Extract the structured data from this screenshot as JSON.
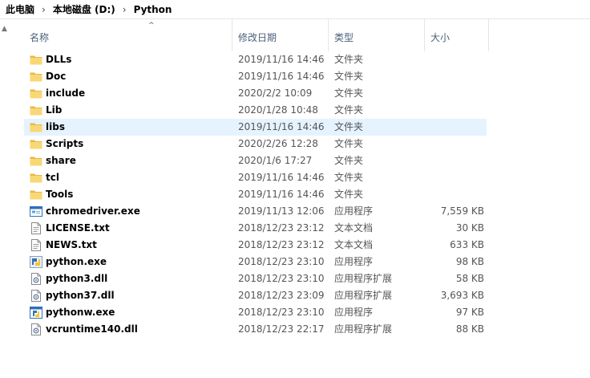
{
  "breadcrumb": [
    "此电脑",
    "本地磁盘 (D:)",
    "Python"
  ],
  "columns": {
    "name": "名称",
    "date": "修改日期",
    "type": "类型",
    "size": "大小"
  },
  "files": [
    {
      "name": "DLLs",
      "date": "2019/11/16 14:46",
      "type": "文件夹",
      "size": "",
      "icon": "folder-icon"
    },
    {
      "name": "Doc",
      "date": "2019/11/16 14:46",
      "type": "文件夹",
      "size": "",
      "icon": "folder-icon"
    },
    {
      "name": "include",
      "date": "2020/2/2 10:09",
      "type": "文件夹",
      "size": "",
      "icon": "folder-icon"
    },
    {
      "name": "Lib",
      "date": "2020/1/28 10:48",
      "type": "文件夹",
      "size": "",
      "icon": "folder-icon"
    },
    {
      "name": "libs",
      "date": "2019/11/16 14:46",
      "type": "文件夹",
      "size": "",
      "icon": "folder-icon"
    },
    {
      "name": "Scripts",
      "date": "2020/2/26 12:28",
      "type": "文件夹",
      "size": "",
      "icon": "folder-icon"
    },
    {
      "name": "share",
      "date": "2020/1/6 17:27",
      "type": "文件夹",
      "size": "",
      "icon": "folder-icon"
    },
    {
      "name": "tcl",
      "date": "2019/11/16 14:46",
      "type": "文件夹",
      "size": "",
      "icon": "folder-icon"
    },
    {
      "name": "Tools",
      "date": "2019/11/16 14:46",
      "type": "文件夹",
      "size": "",
      "icon": "folder-icon"
    },
    {
      "name": "chromedriver.exe",
      "date": "2019/11/13 12:06",
      "type": "应用程序",
      "size": "7,559 KB",
      "icon": "exe-icon"
    },
    {
      "name": "LICENSE.txt",
      "date": "2018/12/23 23:12",
      "type": "文本文档",
      "size": "30 KB",
      "icon": "text-file-icon"
    },
    {
      "name": "NEWS.txt",
      "date": "2018/12/23 23:12",
      "type": "文本文档",
      "size": "633 KB",
      "icon": "text-file-icon"
    },
    {
      "name": "python.exe",
      "date": "2018/12/23 23:10",
      "type": "应用程序",
      "size": "98 KB",
      "icon": "python-icon"
    },
    {
      "name": "python3.dll",
      "date": "2018/12/23 23:10",
      "type": "应用程序扩展",
      "size": "58 KB",
      "icon": "dll-icon"
    },
    {
      "name": "python37.dll",
      "date": "2018/12/23 23:09",
      "type": "应用程序扩展",
      "size": "3,693 KB",
      "icon": "dll-icon"
    },
    {
      "name": "pythonw.exe",
      "date": "2018/12/23 23:10",
      "type": "应用程序",
      "size": "97 KB",
      "icon": "pythonw-icon"
    },
    {
      "name": "vcruntime140.dll",
      "date": "2018/12/23 22:17",
      "type": "应用程序扩展",
      "size": "88 KB",
      "icon": "dll-icon"
    }
  ],
  "hover_row": "libs",
  "colors": {
    "folder": "#f8d775",
    "folder_dark": "#e6b94a",
    "hover": "#e5f3ff",
    "header_text": "#4c607a"
  }
}
